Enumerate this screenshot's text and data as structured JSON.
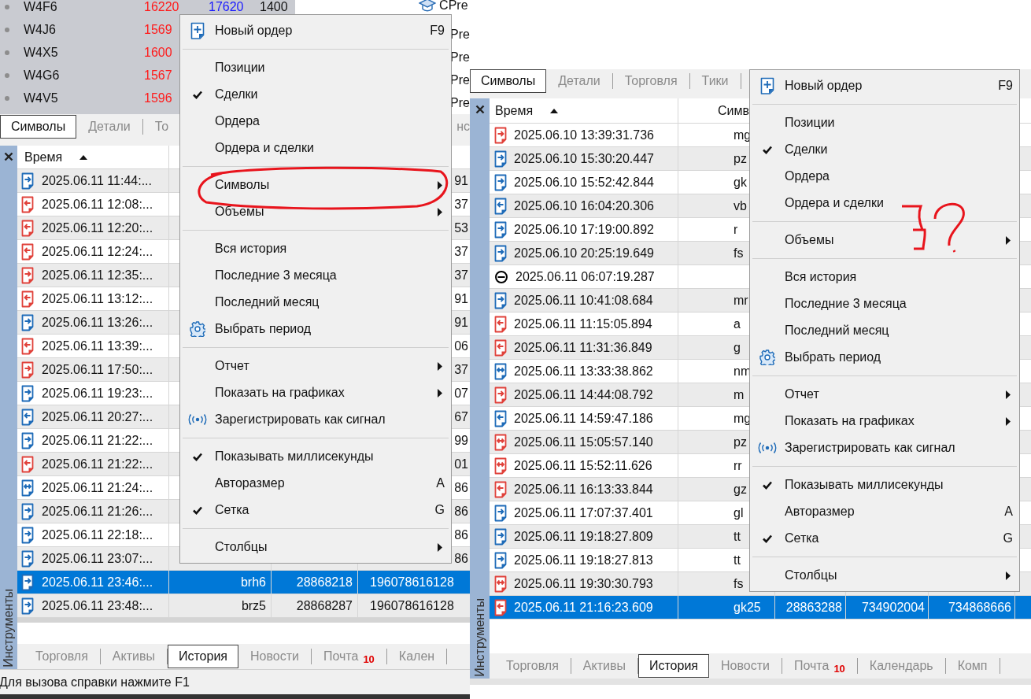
{
  "left_panel": {
    "market_watch": [
      {
        "symbol": "W4F6",
        "bid": "16220",
        "ask": "17620",
        "spread": "1400"
      },
      {
        "symbol": "W4J6",
        "bid": "1569"
      },
      {
        "symbol": "W4X5",
        "bid": "1600"
      },
      {
        "symbol": "W4G6",
        "bid": "1567"
      },
      {
        "symbol": "W4V5",
        "bid": "1596"
      }
    ],
    "navigator": [
      {
        "kind": "course",
        "label": "CPre"
      },
      {
        "kind": "item",
        "label": "Pre"
      },
      {
        "kind": "item",
        "label": "Pre"
      },
      {
        "kind": "item",
        "label": "Pre"
      },
      {
        "kind": "item",
        "label": "Pre"
      }
    ],
    "tabs": [
      {
        "label": "Символы",
        "selected": true
      },
      {
        "label": "Детали",
        "selected": false
      },
      {
        "label": "То",
        "selected": false
      },
      {
        "label": "нс",
        "selected": false
      }
    ],
    "table": {
      "header": "Время",
      "rows": [
        {
          "kind": "right",
          "color": "#1e6bb8",
          "time": "2025.06.11 11:44:...",
          "column_4": "91",
          "selected": false
        },
        {
          "kind": "left",
          "color": "#e0413a",
          "time": "2025.06.11 12:08:...",
          "column_4": "37",
          "selected": false
        },
        {
          "kind": "left",
          "color": "#e0413a",
          "time": "2025.06.11 12:20:...",
          "column_4": "53",
          "selected": false
        },
        {
          "kind": "left",
          "color": "#e0413a",
          "time": "2025.06.11 12:24:...",
          "column_4": "37",
          "selected": false
        },
        {
          "kind": "right",
          "color": "#e0413a",
          "time": "2025.06.11 12:35:...",
          "column_4": "37",
          "selected": false
        },
        {
          "kind": "left",
          "color": "#e0413a",
          "time": "2025.06.11 13:12:...",
          "column_4": "91",
          "selected": false
        },
        {
          "kind": "right",
          "color": "#1e6bb8",
          "time": "2025.06.11 13:26:...",
          "column_4": "91",
          "selected": false
        },
        {
          "kind": "left",
          "color": "#e0413a",
          "time": "2025.06.11 13:39:...",
          "column_4": "06",
          "selected": false
        },
        {
          "kind": "right",
          "color": "#e0413a",
          "time": "2025.06.11 17:50:...",
          "column_4": "37",
          "selected": false
        },
        {
          "kind": "right",
          "color": "#1e6bb8",
          "time": "2025.06.11 19:23:...",
          "column_4": "07",
          "selected": false
        },
        {
          "kind": "left",
          "color": "#1e6bb8",
          "time": "2025.06.11 20:27:...",
          "column_4": "67",
          "selected": false
        },
        {
          "kind": "right",
          "color": "#1e6bb8",
          "time": "2025.06.11 21:22:...",
          "column_4": "99",
          "selected": false
        },
        {
          "kind": "left",
          "color": "#e0413a",
          "time": "2025.06.11 21:22:...",
          "column_4": "01",
          "selected": false
        },
        {
          "kind": "both",
          "color": "#1e6bb8",
          "time": "2025.06.11 21:24:...",
          "column_4": "86",
          "selected": false
        },
        {
          "kind": "right",
          "color": "#1e6bb8",
          "time": "2025.06.11 21:26:...",
          "column_4": "86",
          "selected": false
        },
        {
          "kind": "right",
          "color": "#1e6bb8",
          "time": "2025.06.11 22:18:...",
          "column_4": "86",
          "selected": false
        },
        {
          "kind": "right",
          "color": "#1e6bb8",
          "time": "2025.06.11 23:07:...",
          "column_4": "86",
          "selected": false
        },
        {
          "kind": "right",
          "color": "#1e6bb8",
          "time": "2025.06.11 23:46:...",
          "symbol": "brh6",
          "column_3": "28868218",
          "column_4": "196078616128",
          "selected": true
        },
        {
          "kind": "right",
          "color": "#1e6bb8",
          "time": "2025.06.11 23:48:...",
          "symbol": "brz5",
          "column_3": "28868287",
          "column_4": "196078616128",
          "selected": false
        }
      ]
    },
    "side_label": "Инструменты",
    "bottom_tabs": [
      {
        "label": "Торговля",
        "selected": false
      },
      {
        "label": "Активы",
        "selected": false
      },
      {
        "label": "История",
        "selected": true
      },
      {
        "label": "Новости",
        "selected": false
      },
      {
        "label": "Почта",
        "badge": "10",
        "selected": false
      },
      {
        "label": "Кален",
        "selected": false
      }
    ],
    "status_bar": "Для вызова справки нажмите F1",
    "context_menu": [
      {
        "kind": "new-order",
        "label": "Новый ордер",
        "shortcut": "F9",
        "checked": false,
        "submenu": false
      },
      {
        "kind": "separator"
      },
      {
        "kind": "item",
        "label": "Позиции",
        "checked": false,
        "submenu": false
      },
      {
        "kind": "item",
        "label": "Сделки",
        "checked": true,
        "submenu": false
      },
      {
        "kind": "item",
        "label": "Ордера",
        "checked": false,
        "submenu": false
      },
      {
        "kind": "item",
        "label": "Ордера и сделки",
        "checked": false,
        "submenu": false
      },
      {
        "kind": "separator"
      },
      {
        "kind": "item",
        "label": "Символы",
        "checked": false,
        "submenu": true
      },
      {
        "kind": "item",
        "label": "Объемы",
        "checked": false,
        "submenu": true
      },
      {
        "kind": "separator"
      },
      {
        "kind": "item",
        "label": "Вся история",
        "checked": false,
        "submenu": false
      },
      {
        "kind": "item",
        "label": "Последние 3 месяца",
        "checked": false,
        "submenu": false
      },
      {
        "kind": "item",
        "label": "Последний месяц",
        "checked": false,
        "submenu": false
      },
      {
        "kind": "settings",
        "label": "Выбрать период",
        "checked": false,
        "submenu": false
      },
      {
        "kind": "separator"
      },
      {
        "kind": "item",
        "label": "Отчет",
        "checked": false,
        "submenu": true
      },
      {
        "kind": "item",
        "label": "Показать на графиках",
        "checked": false,
        "submenu": true
      },
      {
        "kind": "signal",
        "label": "Зарегистрировать как сигнал",
        "checked": false,
        "submenu": false
      },
      {
        "kind": "separator"
      },
      {
        "kind": "item",
        "label": "Показывать миллисекунды",
        "checked": true,
        "submenu": false
      },
      {
        "kind": "item",
        "label": "Авторазмер",
        "shortcut": "A",
        "checked": false,
        "submenu": false
      },
      {
        "kind": "item",
        "label": "Сетка",
        "shortcut": "G",
        "checked": true,
        "submenu": false
      },
      {
        "kind": "separator"
      },
      {
        "kind": "item",
        "label": "Столбцы",
        "checked": false,
        "submenu": true
      }
    ]
  },
  "right_panel": {
    "tabs": [
      {
        "label": "Символы",
        "selected": true
      },
      {
        "label": "Детали",
        "selected": false
      },
      {
        "label": "Торговля",
        "selected": false
      },
      {
        "label": "Тики",
        "selected": false
      }
    ],
    "table": {
      "headers": [
        "Время",
        "Симв"
      ],
      "rows": [
        {
          "kind": "right",
          "color": "#e0413a",
          "time": "2025.06.10 13:39:31.736",
          "symbol": "mg",
          "selected": false
        },
        {
          "kind": "right",
          "color": "#1e6bb8",
          "time": "2025.06.10 15:30:20.447",
          "symbol": "pz",
          "selected": false
        },
        {
          "kind": "right",
          "color": "#1e6bb8",
          "time": "2025.06.10 15:52:42.844",
          "symbol": "gk",
          "selected": false
        },
        {
          "kind": "left",
          "color": "#1e6bb8",
          "time": "2025.06.10 16:04:20.306",
          "symbol": "vb",
          "selected": false
        },
        {
          "kind": "right",
          "color": "#1e6bb8",
          "time": "2025.06.10 17:19:00.892",
          "symbol": "r",
          "selected": false
        },
        {
          "kind": "right",
          "color": "#1e6bb8",
          "time": "2025.06.10 20:25:19.649",
          "symbol": "fs",
          "selected": false
        },
        {
          "kind": "minus",
          "color": "#000000",
          "time": "2025.06.11 06:07:19.287",
          "selected": false
        },
        {
          "kind": "right",
          "color": "#1e6bb8",
          "time": "2025.06.11 10:41:08.684",
          "symbol": "mr",
          "selected": false
        },
        {
          "kind": "left",
          "color": "#e0413a",
          "time": "2025.06.11 11:15:05.894",
          "symbol": "a",
          "selected": false
        },
        {
          "kind": "left",
          "color": "#e0413a",
          "time": "2025.06.11 11:31:36.849",
          "symbol": "g",
          "selected": false
        },
        {
          "kind": "both",
          "color": "#1e6bb8",
          "time": "2025.06.11 13:33:38.862",
          "symbol": "nm",
          "selected": false
        },
        {
          "kind": "right",
          "color": "#e0413a",
          "time": "2025.06.11 14:44:08.792",
          "symbol": "m",
          "selected": false
        },
        {
          "kind": "left",
          "color": "#1e6bb8",
          "time": "2025.06.11 14:59:47.186",
          "symbol": "mg",
          "selected": false
        },
        {
          "kind": "both",
          "color": "#e0413a",
          "time": "2025.06.11 15:05:57.140",
          "symbol": "pz",
          "selected": false
        },
        {
          "kind": "both",
          "color": "#e0413a",
          "time": "2025.06.11 15:52:11.626",
          "symbol": "rr",
          "selected": false
        },
        {
          "kind": "left",
          "color": "#e0413a",
          "time": "2025.06.11 16:13:33.844",
          "symbol": "gz",
          "selected": false
        },
        {
          "kind": "right",
          "color": "#1e6bb8",
          "time": "2025.06.11 17:07:37.401",
          "symbol": "gl",
          "selected": false
        },
        {
          "kind": "right",
          "color": "#1e6bb8",
          "time": "2025.06.11 19:18:27.809",
          "symbol": "tt",
          "selected": false
        },
        {
          "kind": "right",
          "color": "#1e6bb8",
          "time": "2025.06.11 19:18:27.813",
          "symbol": "tt",
          "selected": false
        },
        {
          "kind": "both",
          "color": "#e0413a",
          "time": "2025.06.11 19:30:30.793",
          "symbol": "fs",
          "selected": false
        },
        {
          "kind": "left",
          "color": "#e0413a",
          "time": "2025.06.11 21:16:23.609",
          "symbol": "gk25",
          "column_3": "28863288",
          "column_4": "734902004",
          "column_5": "734868666",
          "selected": true
        }
      ]
    },
    "side_label": "Инструменты",
    "bottom_tabs": [
      {
        "label": "Торговля",
        "selected": false
      },
      {
        "label": "Активы",
        "selected": false
      },
      {
        "label": "История",
        "selected": true
      },
      {
        "label": "Новости",
        "selected": false
      },
      {
        "label": "Почта",
        "badge": "10",
        "selected": false
      },
      {
        "label": "Календарь",
        "selected": false
      },
      {
        "label": "Комп",
        "selected": false
      }
    ],
    "context_menu": [
      {
        "kind": "new-order",
        "label": "Новый ордер",
        "shortcut": "F9",
        "checked": false,
        "submenu": false
      },
      {
        "kind": "separator"
      },
      {
        "kind": "item",
        "label": "Позиции",
        "checked": false,
        "submenu": false
      },
      {
        "kind": "item",
        "label": "Сделки",
        "checked": true,
        "submenu": false
      },
      {
        "kind": "item",
        "label": "Ордера",
        "checked": false,
        "submenu": false
      },
      {
        "kind": "item",
        "label": "Ордера и сделки",
        "checked": false,
        "submenu": false
      },
      {
        "kind": "separator"
      },
      {
        "kind": "item",
        "label": "Объемы",
        "checked": false,
        "submenu": true
      },
      {
        "kind": "separator"
      },
      {
        "kind": "item",
        "label": "Вся история",
        "checked": false,
        "submenu": false
      },
      {
        "kind": "item",
        "label": "Последние 3 месяца",
        "checked": false,
        "submenu": false
      },
      {
        "kind": "item",
        "label": "Последний месяц",
        "checked": false,
        "submenu": false
      },
      {
        "kind": "settings",
        "label": "Выбрать период",
        "checked": false,
        "submenu": false
      },
      {
        "kind": "separator"
      },
      {
        "kind": "item",
        "label": "Отчет",
        "checked": false,
        "submenu": true
      },
      {
        "kind": "item",
        "label": "Показать на графиках",
        "checked": false,
        "submenu": true
      },
      {
        "kind": "signal",
        "label": "Зарегистрировать как сигнал",
        "checked": false,
        "submenu": false
      },
      {
        "kind": "separator"
      },
      {
        "kind": "item",
        "label": "Показывать миллисекунды",
        "checked": true,
        "submenu": false
      },
      {
        "kind": "item",
        "label": "Авторазмер",
        "shortcut": "A",
        "checked": false,
        "submenu": false
      },
      {
        "kind": "item",
        "label": "Сетка",
        "shortcut": "G",
        "checked": true,
        "submenu": false
      },
      {
        "kind": "separator"
      },
      {
        "kind": "item",
        "label": "Столбцы",
        "checked": false,
        "submenu": true
      }
    ]
  }
}
